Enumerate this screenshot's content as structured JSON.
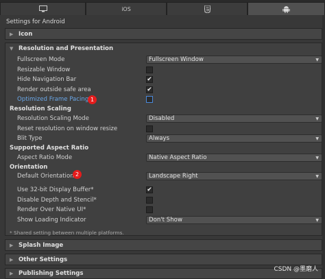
{
  "tabs": [
    {
      "name": "standalone",
      "icon": "monitor-icon",
      "label": ""
    },
    {
      "name": "ios",
      "label": "iOS"
    },
    {
      "name": "webgl",
      "icon": "html5-icon",
      "label": ""
    },
    {
      "name": "android",
      "icon": "android-icon",
      "label": ""
    }
  ],
  "title": "Settings for Android",
  "foldouts": {
    "icon": "Icon",
    "resolution": "Resolution and Presentation",
    "splash": "Splash Image",
    "other": "Other Settings",
    "publishing": "Publishing Settings"
  },
  "resolution": {
    "fullscreen_mode": {
      "label": "Fullscreen Mode",
      "value": "Fullscreen Window"
    },
    "resizable_window": {
      "label": "Resizable Window",
      "checked": false
    },
    "hide_nav_bar": {
      "label": "Hide Navigation Bar",
      "checked": true
    },
    "render_outside_safe": {
      "label": "Render outside safe area",
      "checked": true
    },
    "optimized_frame_pacing": {
      "label": "Optimized Frame Pacing",
      "checked": false,
      "badge": "1"
    }
  },
  "scaling": {
    "header": "Resolution Scaling",
    "mode": {
      "label": "Resolution Scaling Mode",
      "value": "Disabled"
    },
    "reset_on_resize": {
      "label": "Reset resolution on window resize",
      "checked": false
    },
    "blit_type": {
      "label": "Blit Type",
      "value": "Always"
    }
  },
  "aspect": {
    "header": "Supported Aspect Ratio",
    "mode": {
      "label": "Aspect Ratio Mode",
      "value": "Native Aspect Ratio"
    }
  },
  "orientation": {
    "header": "Orientation",
    "default": {
      "label": "Default Orientation",
      "value": "Landscape Right",
      "badge": "2"
    }
  },
  "misc": {
    "display_buffer": {
      "label": "Use 32-bit Display Buffer*",
      "checked": true
    },
    "disable_depth": {
      "label": "Disable Depth and Stencil*",
      "checked": false
    },
    "render_over_native": {
      "label": "Render Over Native UI*",
      "checked": false
    },
    "loading_indicator": {
      "label": "Show Loading Indicator",
      "value": "Don't Show"
    }
  },
  "note": "* Shared setting between multiple platforms.",
  "watermark": "CSDN @墨磨人",
  "icons": {
    "check": "✔",
    "expanded": "▼",
    "collapsed": "▶",
    "caret": "▼"
  }
}
